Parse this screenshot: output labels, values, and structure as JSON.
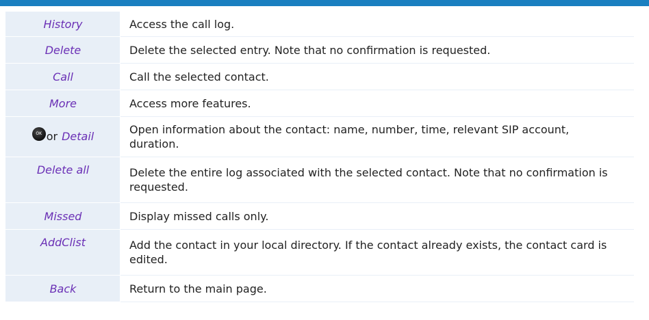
{
  "rows": [
    {
      "key": "History",
      "description": "Access the call log."
    },
    {
      "key": "Delete",
      "description": "Delete the selected entry. Note that no confirmation is requested."
    },
    {
      "key": "Call",
      "description": "Call the selected contact."
    },
    {
      "key": "More",
      "description": "Access more features."
    },
    {
      "key_icon": "ok-key-icon",
      "key_icon_label": "OK",
      "key_connector": "or",
      "key": "Detail",
      "description": "Open information about the contact: name, number, time, relevant SIP account, duration."
    },
    {
      "key": "Delete all",
      "description": "Delete the entire log associated with the selected contact. Note that no confirmation is requested."
    },
    {
      "key": "Missed",
      "description": "Display missed calls only."
    },
    {
      "key": "AddClist",
      "description": "Add the contact in your local directory. If the contact already exists, the contact card is edited."
    },
    {
      "key": "Back",
      "description": "Return to the main page."
    }
  ],
  "colors": {
    "header_band": "#1a7fc0",
    "key_cell_background": "#e8eff7",
    "key_text": "#6a2fb5",
    "body_text": "#222222"
  }
}
